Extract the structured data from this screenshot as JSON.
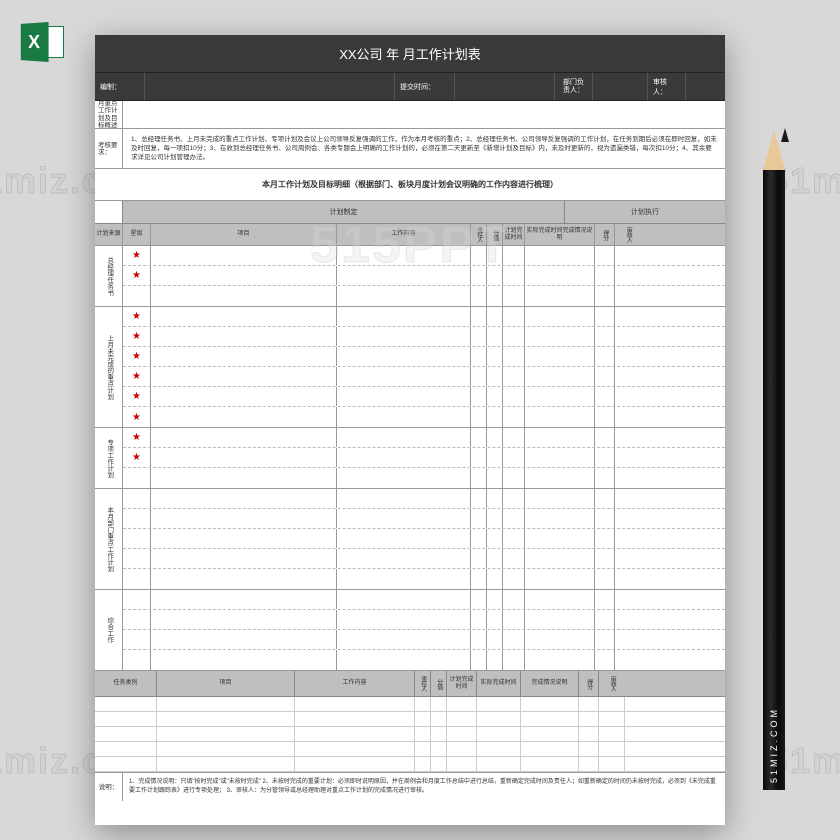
{
  "badge": {
    "letter": "X"
  },
  "pencil": {
    "text": "51MIZ.COM"
  },
  "watermarks": {
    "miz": "51miz.com",
    "ppt": "515PPT"
  },
  "title": "XX公司      年     月工作计划表",
  "infoBar": {
    "preparerLabel": "编制：",
    "submitLabel": "提交时间：",
    "deptLabel": "部门负责人：",
    "reviewLabel": "审核人："
  },
  "overview": {
    "label": "月重点工作计划及目标概述",
    "text": ""
  },
  "assessment": {
    "label": "考核要求：",
    "text": "1、总经理任务书、上月未完成的重点工作计划、专项计划及会议上公司领导反复强调的工作，作为本月考核的重点；2、总经理任务书、公司领导反复强调的工作计划，在任务到期后必须在即时回复，如未及时回复，每一项扣10分；3、在收到总经理任务书、公司周例会、各类专题会上明确的工作计划的，必须在第二天更新至《新增计划及目标》内，未及时更新的，视为遗漏类错，每次扣10分；4、其余要求详见公司计划管理办法。"
  },
  "subtitle": "本月工作计划及目标明细（根据部门、板块月度计划会议明确的工作内容进行梳理）",
  "sectionHead": {
    "make": "计划制定",
    "exec": "计划执行"
  },
  "cols": {
    "source": "计划来源",
    "level": "星级",
    "project": "项目",
    "content": "工作内容",
    "resp": "责任人",
    "score": "分值",
    "planTime": "计划完成时间",
    "actTime": "实际完成时间完成情况说明",
    "points": "得分",
    "reviewer": "审核人"
  },
  "blocks": [
    {
      "label": "总经理任务书",
      "rows": 3,
      "stars": [
        true,
        true,
        false
      ]
    },
    {
      "label": "上月未完成的重点计划",
      "rows": 6,
      "stars": [
        true,
        true,
        true,
        true,
        true,
        true
      ]
    },
    {
      "label": "专项工作计划",
      "rows": 3,
      "stars": [
        true,
        true,
        false
      ]
    },
    {
      "label": "本月部门重点工作计划",
      "rows": 5,
      "stars": [
        false,
        false,
        false,
        false,
        false
      ]
    },
    {
      "label": "综合工作",
      "rows": 4,
      "stars": [
        false,
        false,
        false,
        false
      ]
    }
  ],
  "taskHead": {
    "category": "任务类别",
    "project": "项目",
    "content": "工作内容",
    "resp": "责任人",
    "score": "分值",
    "planTime": "计划完成时间",
    "actTime": "实际完成时间",
    "status": "完成情况说明",
    "points": "得分",
    "reviewer": "审核人"
  },
  "taskRows": 5,
  "footer": {
    "label": "说明：",
    "text": "1、完成情况说明：只填\"按时完成\"或\"未按时完成\"\n2、未按时完成的重要计划：必须即时说明原因，并在周例会和月度工作总结中进行总结，重新确定完成时间及责任人；如重新确定的时间仍未按时完成，必须到《未完成重要工作计划跟踪表》进行专项处理；\n3、审核人：为分管领导或总经理助理对重点工作计划的完成情况进行审核。"
  }
}
